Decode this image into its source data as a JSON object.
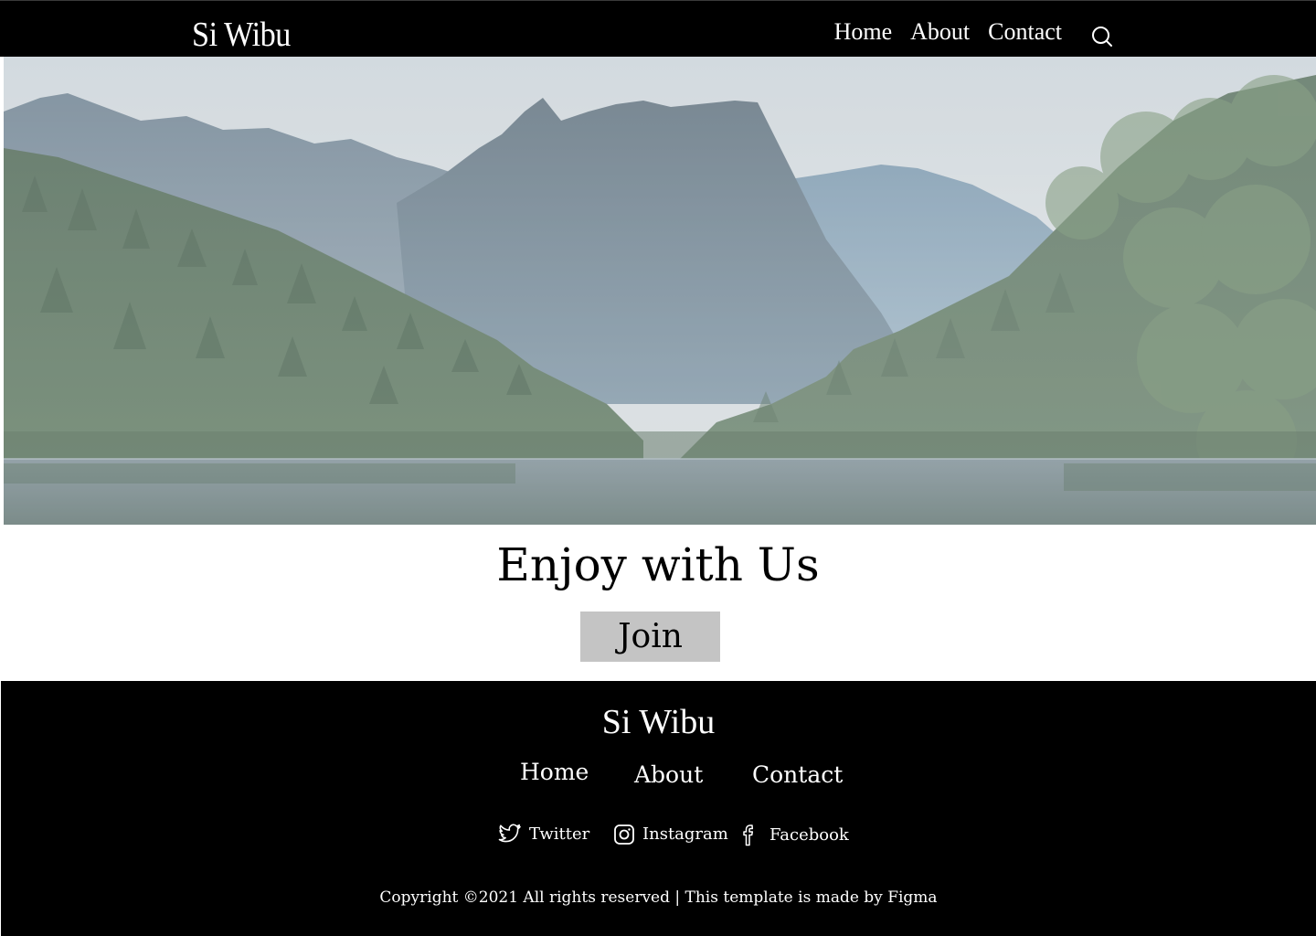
{
  "header": {
    "brand": "Si Wibu",
    "nav": [
      "Home",
      "About",
      "Contact"
    ],
    "search_icon": "search-icon"
  },
  "hero": {
    "image": "mountain-lake-forest-photo"
  },
  "cta": {
    "heading": "Enjoy with Us",
    "button_label": "Join"
  },
  "footer": {
    "brand": "Si Wibu",
    "nav": [
      "Home",
      "About",
      "Contact"
    ],
    "social": [
      {
        "label": "Twitter",
        "icon": "twitter-icon"
      },
      {
        "label": "Instagram",
        "icon": "instagram-icon"
      },
      {
        "label": "Facebook",
        "icon": "facebook-icon"
      }
    ],
    "copyright": "Copyright ©2021 All rights reserved | This template is made by Figma"
  },
  "colors": {
    "bar_background": "#000000",
    "button_background": "#c4c4c4",
    "page_background": "#ffffff"
  }
}
